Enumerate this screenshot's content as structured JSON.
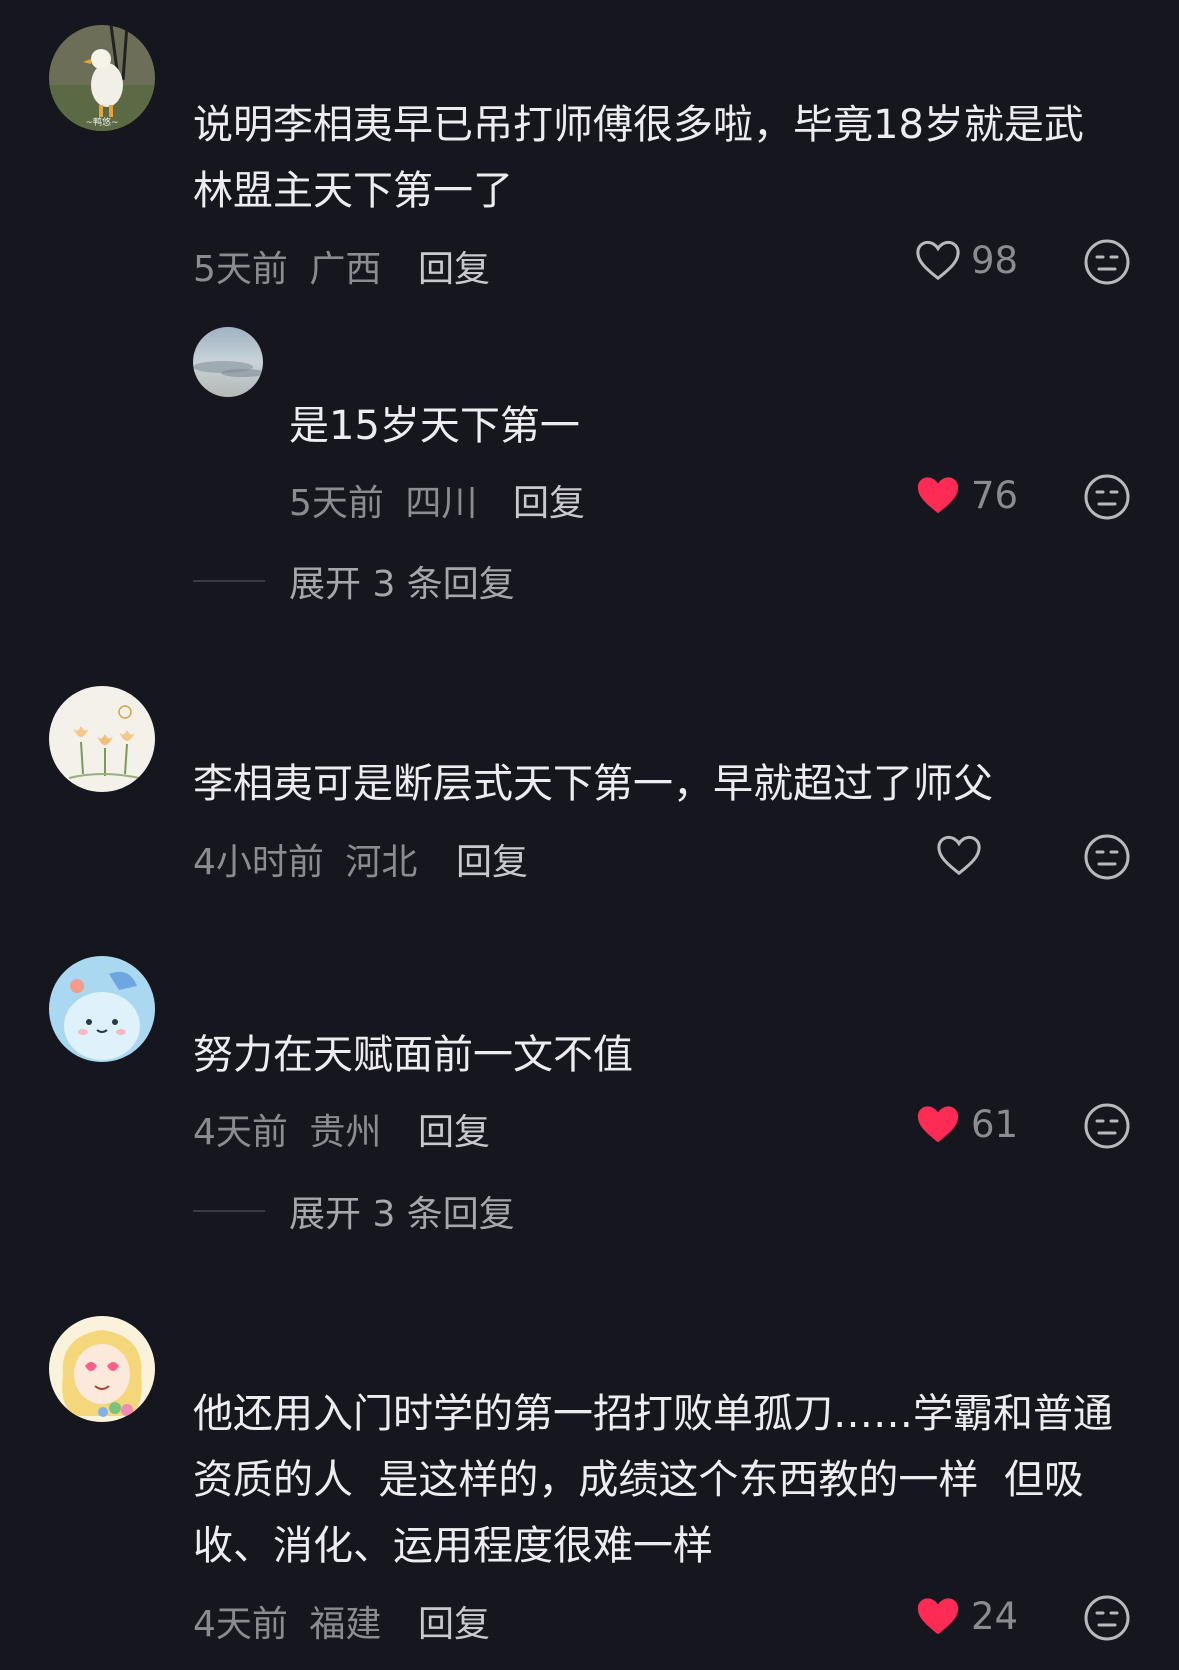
{
  "comments": [
    {
      "text": "说明李相夷早已吊打师傅很多啦，毕竟18岁就是武林盟主天下第一了",
      "time": "5天前",
      "location": "广西",
      "reply_label": "回复",
      "likes": "98",
      "liked": false,
      "avatar_caption": "~鸭悠~",
      "replies": [
        {
          "text": "是15岁天下第一",
          "time": "5天前",
          "location": "四川",
          "reply_label": "回复",
          "likes": "76",
          "liked": true
        }
      ],
      "expand_label": "展开 3 条回复"
    },
    {
      "text": "李相夷可是断层式天下第一，早就超过了师父",
      "time": "4小时前",
      "location": "河北",
      "reply_label": "回复",
      "likes": "",
      "liked": false
    },
    {
      "text": "努力在天赋面前一文不值",
      "time": "4天前",
      "location": "贵州",
      "reply_label": "回复",
      "likes": "61",
      "liked": true,
      "expand_label": "展开 3 条回复"
    },
    {
      "text": "他还用入门时学的第一招打败单孤刀……学霸和普通资质的人 是这样的，成绩这个东西教的一样 但吸收、消化、运用程度很难一样",
      "line1": "他还用入门时学的第一招打败单孤刀……学霸和普通",
      "line2": "资质的人  是这样的，成绩这个东西教的一样  但吸",
      "line3": "收、消化、运用程度很难一样",
      "time": "4天前",
      "location": "福建",
      "reply_label": "回复",
      "likes": "24",
      "liked": true
    }
  ],
  "colors": {
    "background": "#16161e",
    "like_active": "#fe2c55",
    "meta_gray": "#8b8b92"
  }
}
